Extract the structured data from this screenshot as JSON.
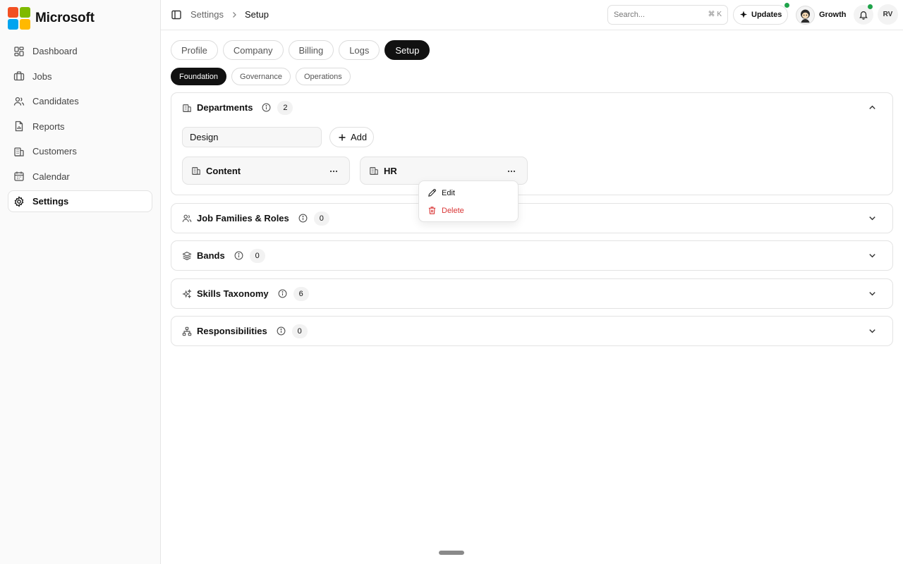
{
  "brand": {
    "name": "Microsoft",
    "logo_colors": [
      "#f25022",
      "#7fba00",
      "#00a4ef",
      "#ffb900"
    ]
  },
  "sidebar": {
    "items": [
      {
        "label": "Dashboard",
        "icon": "dashboard-icon"
      },
      {
        "label": "Jobs",
        "icon": "briefcase-icon"
      },
      {
        "label": "Candidates",
        "icon": "users-icon"
      },
      {
        "label": "Reports",
        "icon": "report-icon"
      },
      {
        "label": "Customers",
        "icon": "building-icon"
      },
      {
        "label": "Calendar",
        "icon": "calendar-icon"
      },
      {
        "label": "Settings",
        "icon": "gear-icon",
        "active": true
      }
    ]
  },
  "header": {
    "breadcrumb": [
      "Settings",
      "Setup"
    ],
    "search_placeholder": "Search...",
    "search_shortcut": "⌘ K",
    "updates_label": "Updates",
    "workspace_label": "Growth",
    "user_initials": "RV",
    "status_color": "#1fa34a"
  },
  "tabs": {
    "main": [
      "Profile",
      "Company",
      "Billing",
      "Logs",
      "Setup"
    ],
    "main_active": "Setup",
    "sub": [
      "Foundation",
      "Governance",
      "Operations"
    ],
    "sub_active": "Foundation"
  },
  "departments": {
    "title": "Departments",
    "count": "2",
    "input_value": "Design",
    "add_label": "Add",
    "items": [
      "Content",
      "HR"
    ]
  },
  "context_menu": {
    "edit_label": "Edit",
    "delete_label": "Delete",
    "delete_color": "#d93636"
  },
  "sections": [
    {
      "title": "Job Families & Roles",
      "count": "0",
      "icon": "users-icon"
    },
    {
      "title": "Bands",
      "count": "0",
      "icon": "layers-icon"
    },
    {
      "title": "Skills Taxonomy",
      "count": "6",
      "icon": "sparkles-icon"
    },
    {
      "title": "Responsibilities",
      "count": "0",
      "icon": "hierarchy-icon"
    }
  ]
}
